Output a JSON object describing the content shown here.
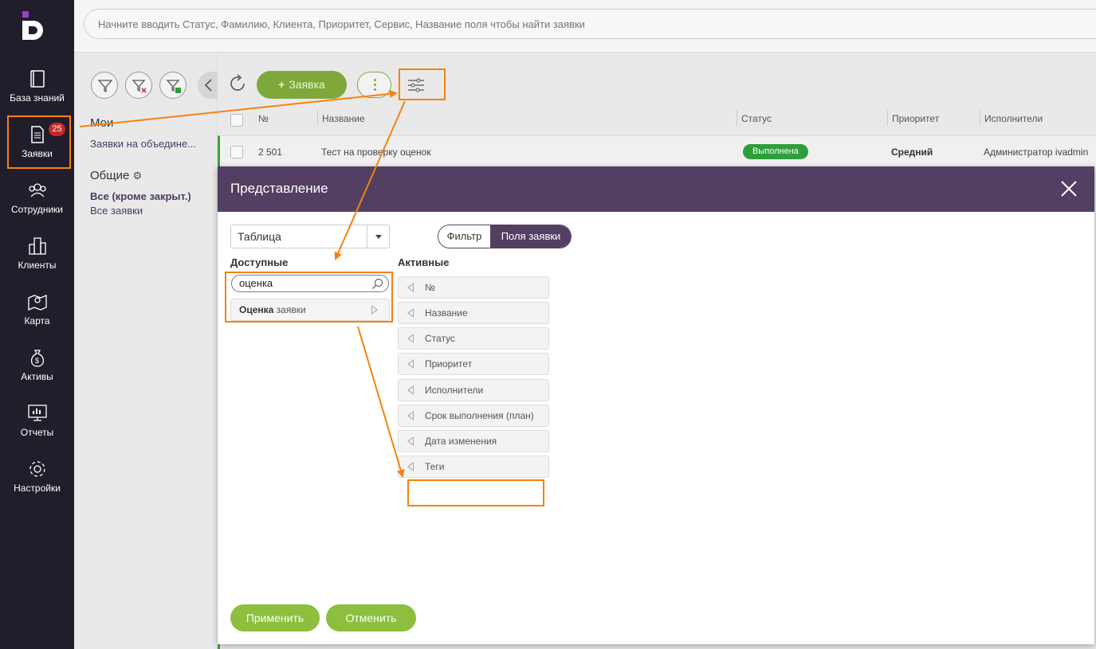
{
  "sidebar": {
    "items": [
      {
        "label": "База знаний"
      },
      {
        "label": "Заявки",
        "badge": "25"
      },
      {
        "label": "Сотрудники"
      },
      {
        "label": "Клиенты"
      },
      {
        "label": "Карта"
      },
      {
        "label": "Активы"
      },
      {
        "label": "Отчеты"
      },
      {
        "label": "Настройки"
      }
    ]
  },
  "search": {
    "placeholder": "Начните вводить Статус, Фамилию, Клиента, Приоритет, Сервис, Название поля чтобы найти заявки"
  },
  "filters": {
    "my_title": "Мои",
    "my_items": [
      "Заявки на объедине..."
    ],
    "common_title": "Общие",
    "common_items": [
      "Все (кроме закрыт.)",
      "Все заявки"
    ]
  },
  "toolbar": {
    "add_label": "Заявка",
    "add_plus": "+"
  },
  "table": {
    "columns": [
      "№",
      "Название",
      "Статус",
      "Приоритет",
      "Исполнители"
    ],
    "rows": [
      {
        "num": "2 501",
        "name": "Тест на проверку оценок",
        "status": "Выполнена",
        "priority": "Средний",
        "assignee": "Администратор ivadmin"
      }
    ]
  },
  "modal": {
    "title": "Представление",
    "view_value": "Таблица",
    "tabs": {
      "filter": "Фильтр",
      "fields": "Поля заявки"
    },
    "available_title": "Доступные",
    "active_title": "Активные",
    "field_search_value": "оценка",
    "available_items": [
      {
        "bold": "Оценка",
        "rest": " заявки"
      }
    ],
    "active_items": [
      "№",
      "Название",
      "Статус",
      "Приоритет",
      "Исполнители",
      "Срок выполнения (план)",
      "Дата изменения",
      "Теги"
    ],
    "apply_label": "Применить",
    "cancel_label": "Отменить"
  },
  "colors": {
    "sidebar_bg": "#221d2a",
    "accent_purple": "#533f62",
    "accent_green": "#8bbf3d",
    "status_green": "#2e9e3a",
    "annotation_orange": "#f5820e"
  }
}
